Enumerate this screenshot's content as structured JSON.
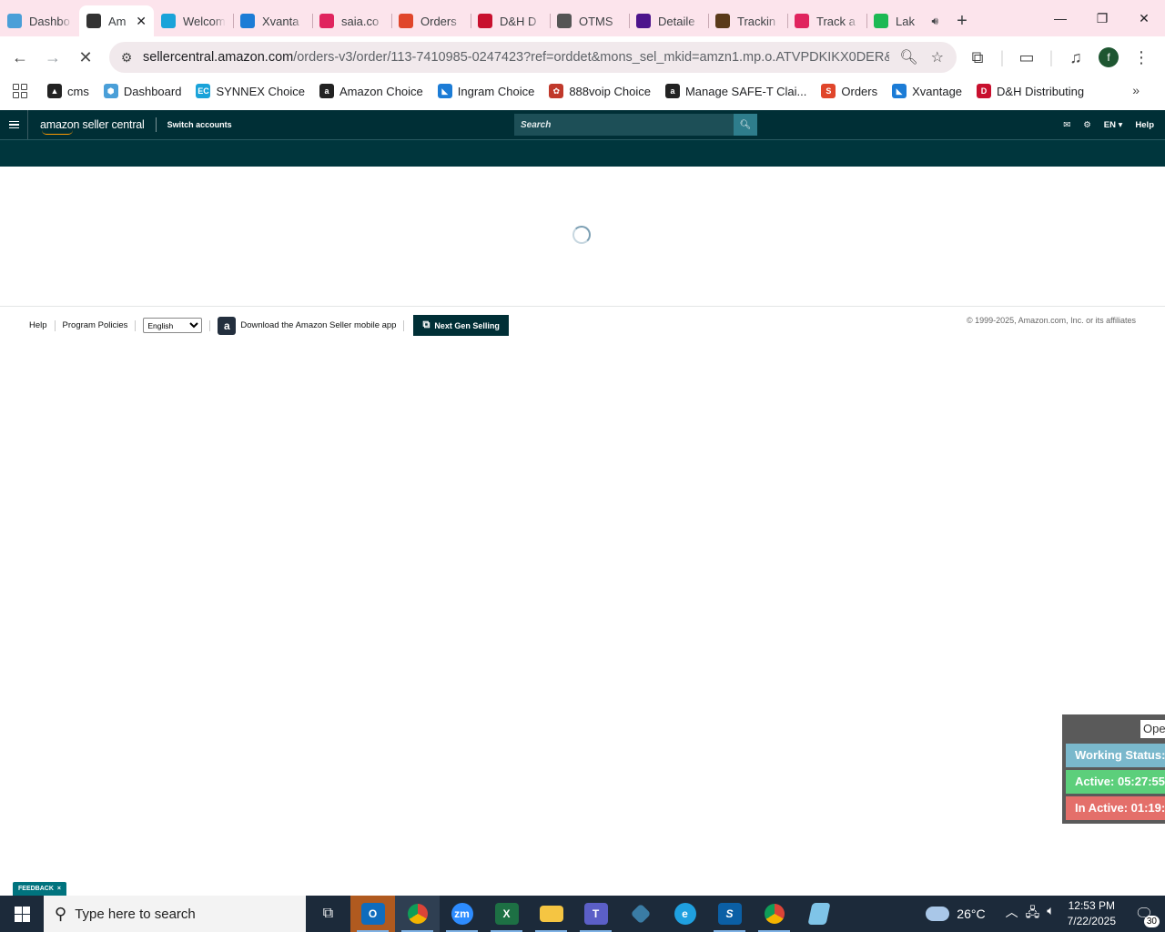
{
  "browser": {
    "tabs": [
      {
        "title": "Dashbo",
        "icon": "cms-hex-icon",
        "color": "#4a9fd8"
      },
      {
        "title": "Am",
        "icon": "amazon-eye-icon",
        "color": "#333333",
        "active": true
      },
      {
        "title": "Welcom",
        "icon": "ec-icon",
        "color": "#1aa3d9"
      },
      {
        "title": "Xvanta",
        "icon": "xvantage-icon",
        "color": "#1c7cd6"
      },
      {
        "title": "saia.co",
        "icon": "saia-icon",
        "color": "#e0245e"
      },
      {
        "title": "Orders",
        "icon": "orders-swirl-icon",
        "color": "#e0462b"
      },
      {
        "title": "D&H D",
        "icon": "dh-icon",
        "color": "#c8102e"
      },
      {
        "title": "OTMS",
        "icon": "otms-icon",
        "color": "#555555"
      },
      {
        "title": "Detaile",
        "icon": "fedex-icon",
        "color": "#4d148c"
      },
      {
        "title": "Trackin",
        "icon": "ups-icon",
        "color": "#5a3a1a"
      },
      {
        "title": "Track a",
        "icon": "saia-icon",
        "color": "#e0245e"
      },
      {
        "title": "Lak",
        "icon": "spotify-icon",
        "color": "#1db954",
        "audio": true
      }
    ],
    "new_tab_label": "+",
    "url_domain": "sellercentral.amazon.com",
    "url_path": "/orders-v3/order/113-7410985-0247423?ref=orddet&mons_sel_mkid=amzn1.mp.o.ATVPDKIKX0DER&mo...",
    "profile_initial": "f",
    "bookmarks": [
      {
        "label": "cms",
        "color": "#222222",
        "glyph": "▲"
      },
      {
        "label": "Dashboard",
        "color": "#4a9fd8",
        "glyph": "⬢"
      },
      {
        "label": "SYNNEX Choice",
        "color": "#1aa3d9",
        "glyph": "EC"
      },
      {
        "label": "Amazon Choice",
        "color": "#222222",
        "glyph": "a"
      },
      {
        "label": "Ingram Choice",
        "color": "#1c7cd6",
        "glyph": "◣"
      },
      {
        "label": "888voip Choice",
        "color": "#c0392b",
        "glyph": "✿"
      },
      {
        "label": "Manage SAFE-T Clai...",
        "color": "#222222",
        "glyph": "a"
      },
      {
        "label": "Orders",
        "color": "#e0462b",
        "glyph": "S"
      },
      {
        "label": "Xvantage",
        "color": "#1c7cd6",
        "glyph": "◣"
      },
      {
        "label": "D&H Distributing",
        "color": "#c8102e",
        "glyph": "D"
      }
    ]
  },
  "seller_central": {
    "logo_text": "amazon seller central",
    "switch_accounts": "Switch accounts",
    "search_placeholder": "Search",
    "language": "EN",
    "help": "Help"
  },
  "footer": {
    "help": "Help",
    "program_policies": "Program Policies",
    "language_selected": "English",
    "download_app": "Download the Amazon Seller mobile app",
    "next_gen": "Next Gen Selling",
    "copyright": "© 1999-2025, Amazon.com, Inc. or its affiliates"
  },
  "status_widget": {
    "open_label": "Ope",
    "working_status": "Working Status: A",
    "active": "Active: 05:27:55",
    "inactive": "In Active: 01:19:4"
  },
  "feedback": "FEEDBACK",
  "taskbar": {
    "search_placeholder": "Type here to search",
    "weather": "26°C",
    "time": "12:53 PM",
    "date": "7/22/2025",
    "notifications": "30"
  }
}
